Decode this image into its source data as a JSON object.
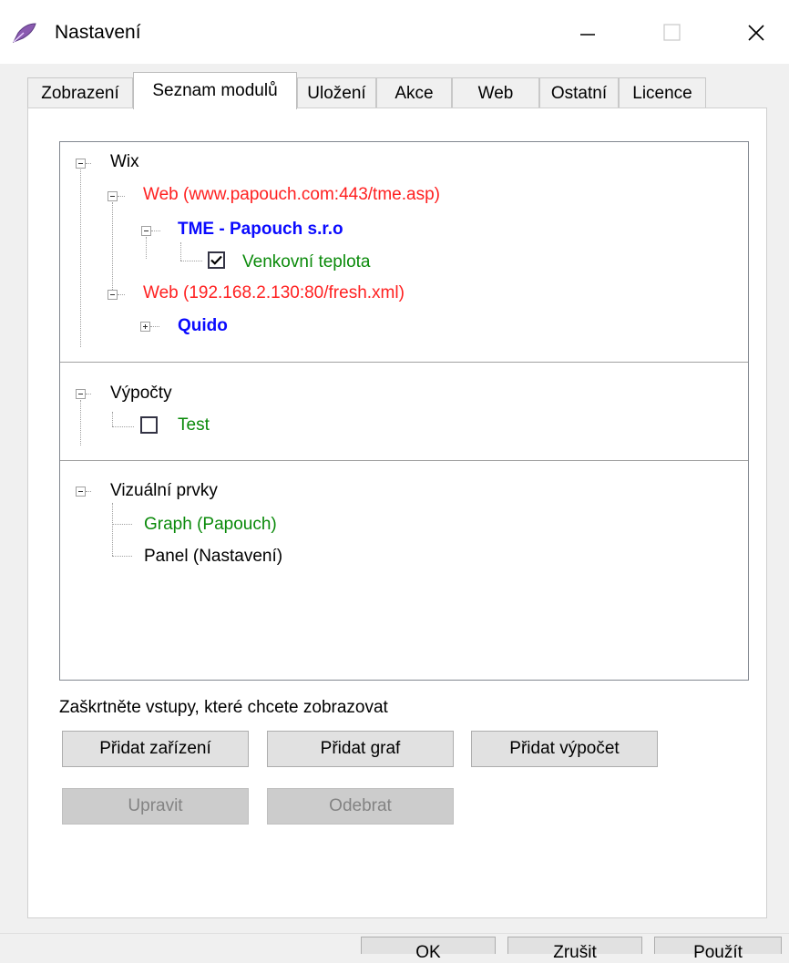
{
  "window": {
    "title": "Nastavení"
  },
  "tabs": [
    {
      "label": "Zobrazení"
    },
    {
      "label": "Seznam modulů",
      "active": true
    },
    {
      "label": "Uložení"
    },
    {
      "label": "Akce"
    },
    {
      "label": "Web"
    },
    {
      "label": "Ostatní"
    },
    {
      "label": "Licence"
    }
  ],
  "tree": {
    "wix": {
      "label": "Wix",
      "web1": {
        "label": "Web (www.papouch.com:443/tme.asp)",
        "device": "TME - Papouch s.r.o",
        "input": "Venkovní teplota",
        "input_checked": true
      },
      "web2": {
        "label": "Web (192.168.2.130:80/fresh.xml)",
        "device": "Quido"
      }
    },
    "calc": {
      "label": "Výpočty",
      "item": "Test",
      "item_checked": false
    },
    "visual": {
      "label": "Vizuální prvky",
      "items": [
        "Graph (Papouch)",
        "Panel (Nastavení)"
      ]
    }
  },
  "hint": "Zaškrtněte vstupy, které chcete zobrazovat",
  "buttons": {
    "add_device": "Přidat zařízení",
    "add_graph": "Přidat graf",
    "add_calc": "Přidat výpočet",
    "edit": "Upravit",
    "remove": "Odebrat",
    "ok": "OK",
    "cancel": "Zrušit",
    "apply": "Použít"
  },
  "colors": {
    "module": "#ff2020",
    "device": "#0a0aff",
    "input": "#0a8a0a"
  }
}
